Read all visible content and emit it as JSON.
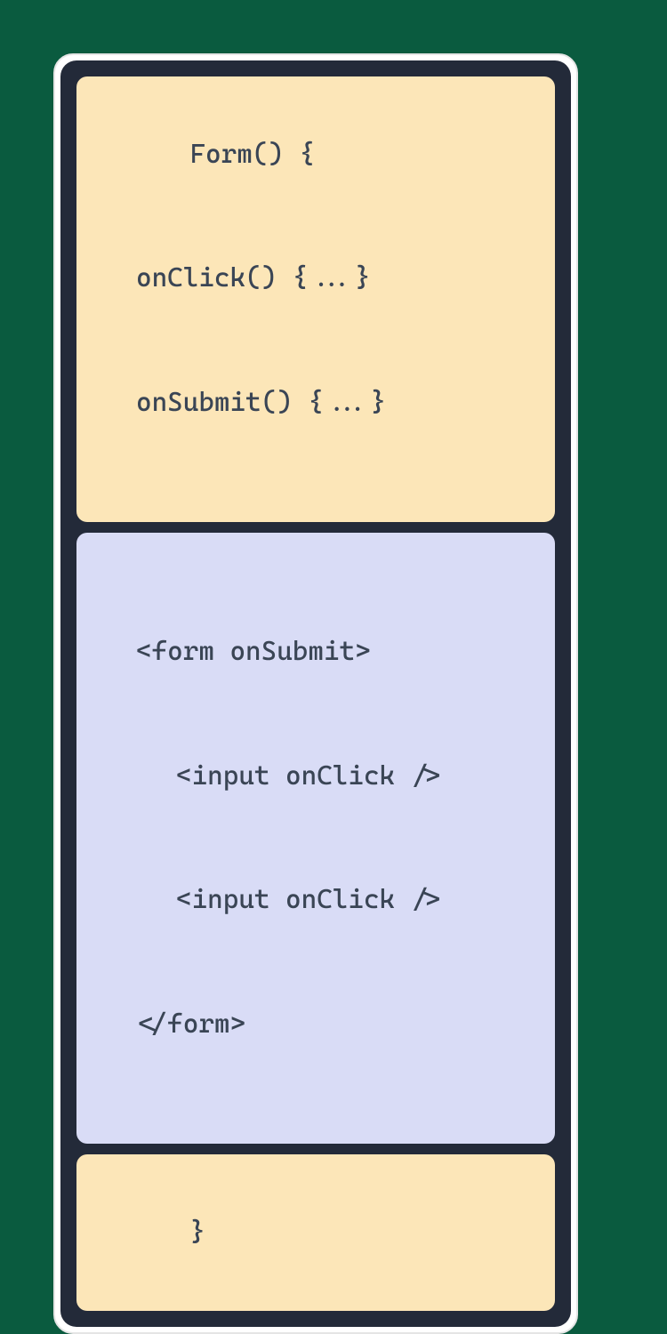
{
  "diagram": {
    "top": {
      "line1": "Form() {",
      "line2": "onClick() {...}",
      "line3": "onSubmit() {...}"
    },
    "middle": {
      "line1": "<form onSubmit>",
      "line2": "<input onClick />",
      "line3": "<input onClick />",
      "line4": "</form>"
    },
    "bottom": {
      "line1": "}"
    }
  }
}
